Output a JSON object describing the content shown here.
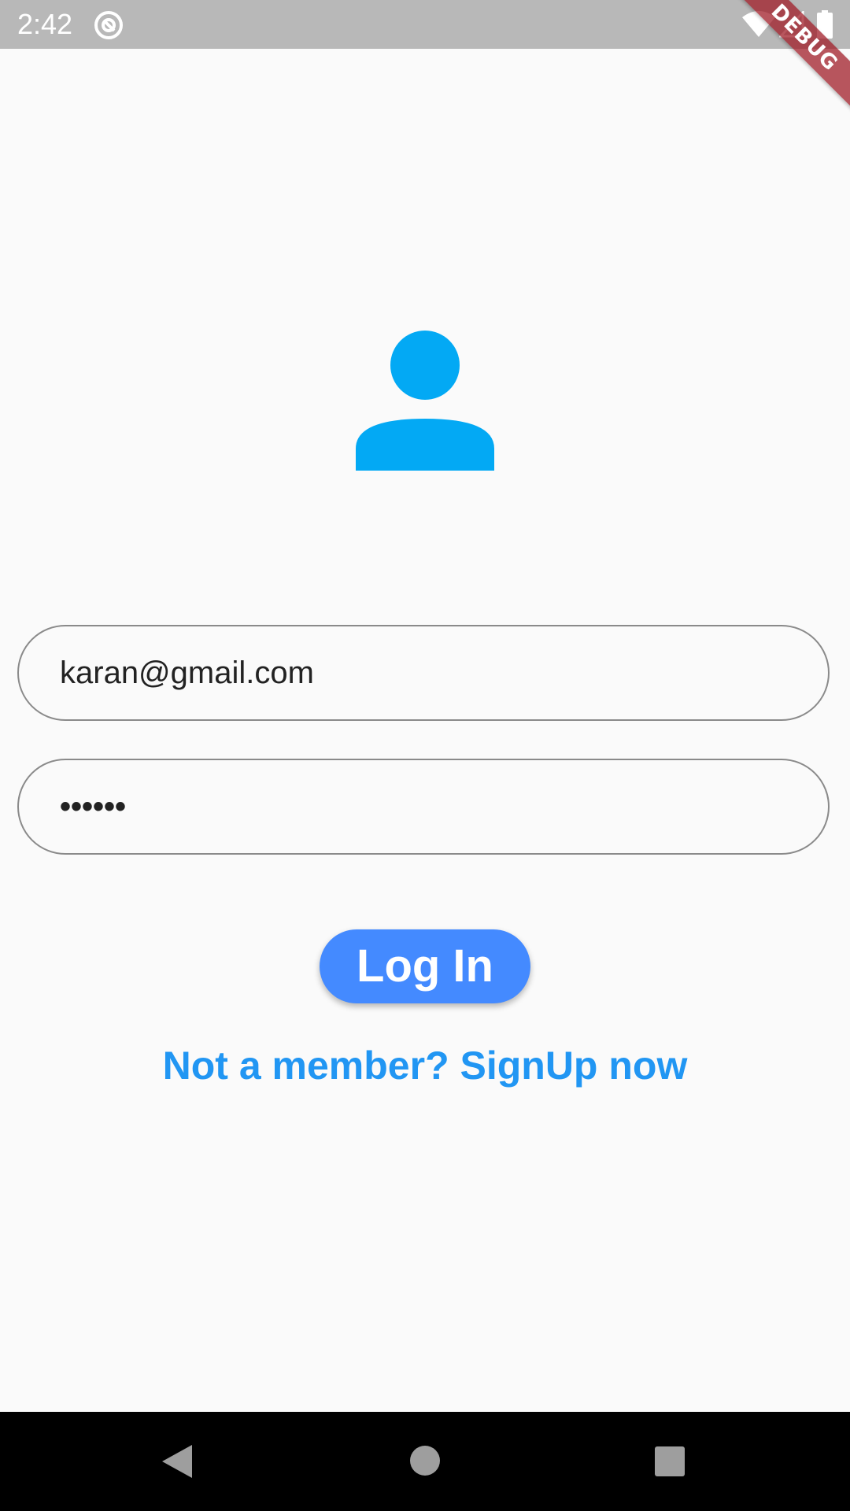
{
  "status_bar": {
    "time": "2:42",
    "icons": [
      "app-notification-icon",
      "wifi-icon",
      "signal-icon",
      "battery-icon"
    ]
  },
  "debug_banner": {
    "label": "DEBUG"
  },
  "avatar": {
    "icon": "person-icon",
    "color": "#03a9f4"
  },
  "login_form": {
    "email_value": "karan@gmail.com",
    "password_value": "••••••",
    "login_button_label": "Log In",
    "signup_link_label": "Not a member? SignUp now"
  },
  "colors": {
    "background": "#fafafa",
    "primary_button": "#448aff",
    "link": "#2196f3",
    "input_border": "#8a8a8a"
  },
  "nav_bar": {
    "icons": [
      "back-icon",
      "home-icon",
      "recents-icon"
    ]
  }
}
